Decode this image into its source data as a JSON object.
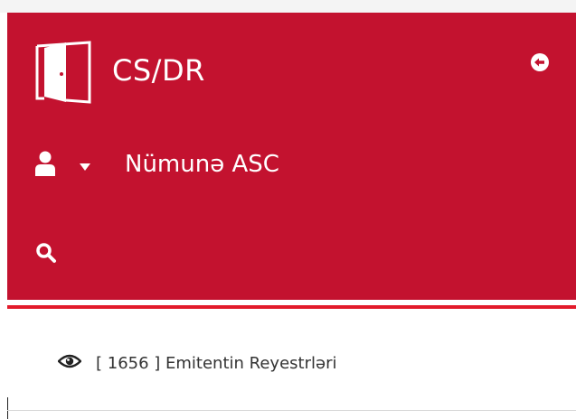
{
  "header": {
    "brand_title": "CS/DR",
    "user_name": "Nümunə ASC",
    "icons": {
      "logo": "door-icon",
      "collapse": "arrow-circle-left-icon",
      "user": "user-icon",
      "caret": "caret-down-icon",
      "search": "search-icon"
    }
  },
  "menu": {
    "items": [
      {
        "icon": "eye-icon",
        "label": "[ 1656 ] Emitentin Reyestrləri"
      }
    ]
  },
  "colors": {
    "header_bg": "#c3122f",
    "accent_line": "#e21b2b",
    "header_text": "#ffffff",
    "menu_text": "#333333"
  }
}
